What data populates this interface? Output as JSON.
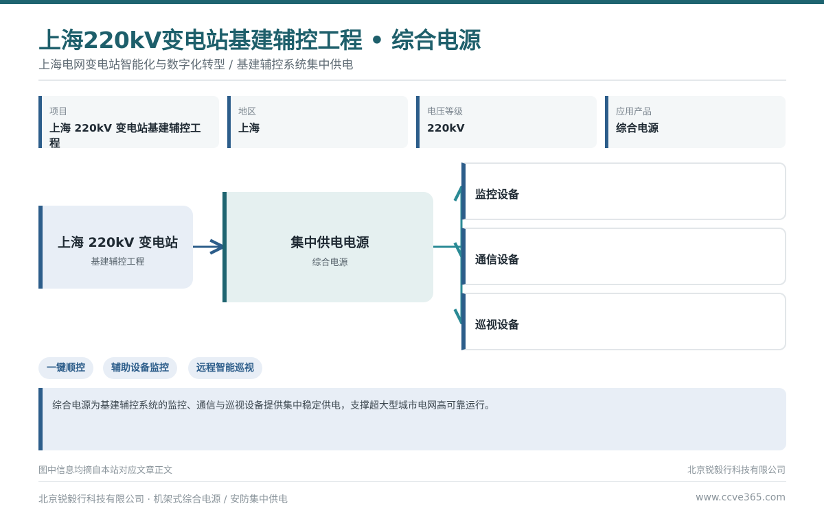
{
  "header": {
    "title": "上海220kV变电站基建辅控工程 • 综合电源",
    "subtitle": "上海电网变电站智能化与数字化转型 / 基建辅控系统集中供电"
  },
  "info_cards": [
    {
      "label": "项目",
      "value": "上海 220kV 变电站基建辅控工程"
    },
    {
      "label": "地区",
      "value": "上海"
    },
    {
      "label": "电压等级",
      "value": "220kV"
    },
    {
      "label": "应用产品",
      "value": "综合电源"
    }
  ],
  "diagram": {
    "source": {
      "title": "上海 220kV 变电站",
      "subtitle": "基建辅控工程"
    },
    "hub": {
      "title": "集中供电电源",
      "subtitle": "综合电源"
    },
    "devices": [
      "监控设备",
      "通信设备",
      "巡视设备"
    ]
  },
  "tags": [
    "一键顺控",
    "辅助设备监控",
    "远程智能巡视"
  ],
  "note": "综合电源为基建辅控系统的监控、通信与巡视设备提供集中稳定供电，支撑超大型城市电网高可靠运行。",
  "source_line": {
    "left": "图中信息均摘自本站对应文章正文",
    "right": "北京锐毅行科技有限公司"
  },
  "footer": {
    "left": "北京锐毅行科技有限公司 · 机架式综合电源 / 安防集中供电",
    "right": "www.ccve365.com"
  },
  "colors": {
    "accent_teal": "#1e6470",
    "accent_blue": "#2c5d8a",
    "connector": "#2a8a95"
  }
}
